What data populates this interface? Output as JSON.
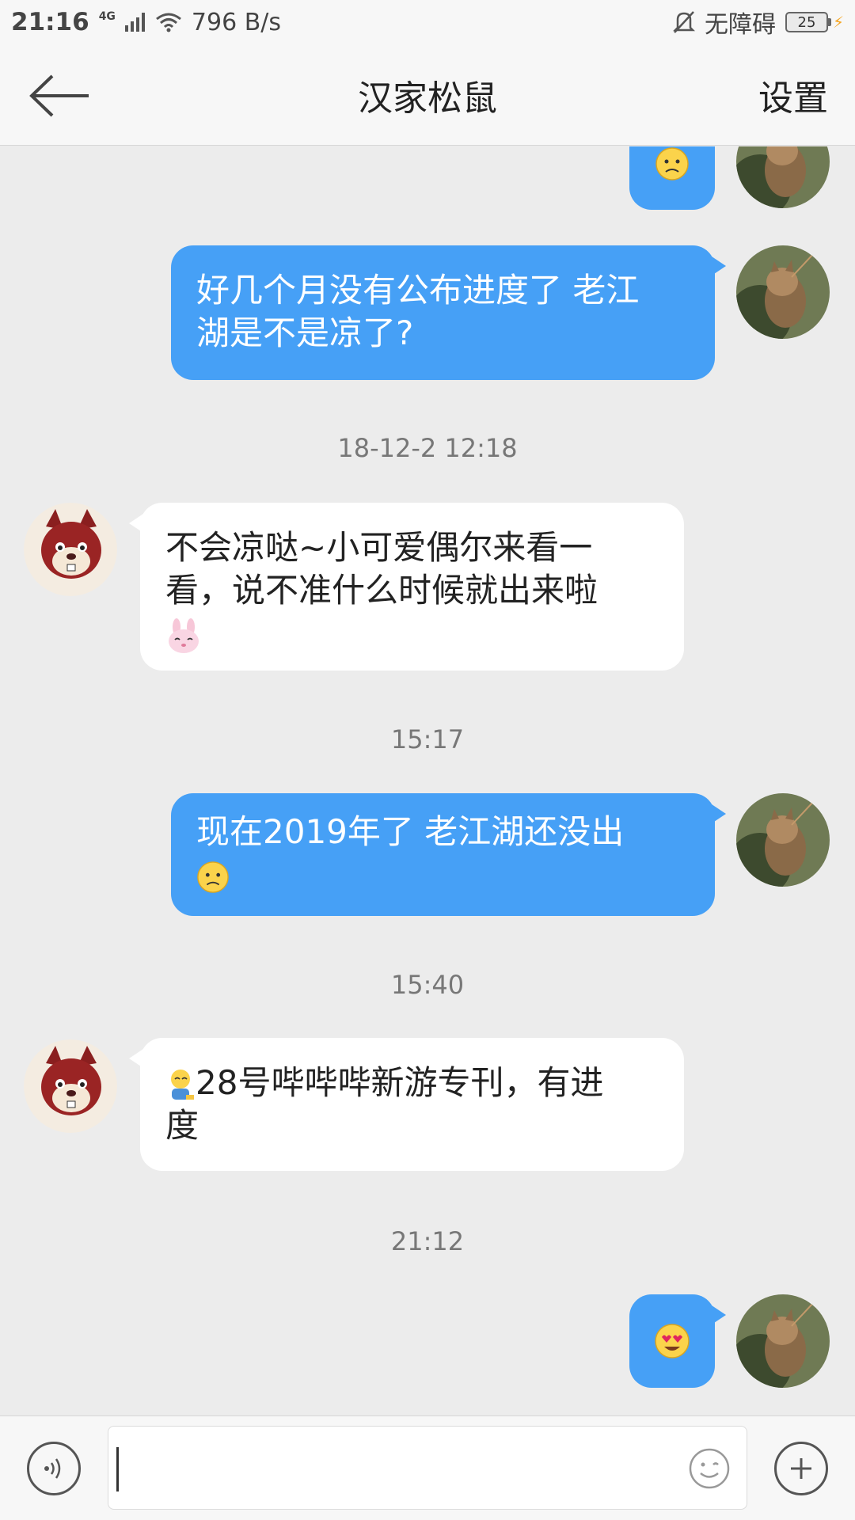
{
  "status_bar": {
    "time": "21:16",
    "network": "4G",
    "speed": "796 B/s",
    "accessibility": "无障碍",
    "battery": "25"
  },
  "header": {
    "title": "汉家松鼠",
    "settings_label": "设置"
  },
  "messages": [
    {
      "from": "self",
      "text": "好几个月没有公布进度了 老江湖是不是凉了?"
    },
    {
      "timestamp": "18-12-2 12:18"
    },
    {
      "from": "other",
      "text": "不会凉哒~小可爱偶尔来看一看，说不准什么时候就出来啦"
    },
    {
      "timestamp": "15:17"
    },
    {
      "from": "self",
      "text": "现在2019年了   老江湖还没出"
    },
    {
      "timestamp": "15:40"
    },
    {
      "from": "other",
      "text": "28号哔哔哔新游专刊，有进度"
    },
    {
      "timestamp": "21:12"
    }
  ],
  "texts": {
    "msg1_line1": "好几个月没有公布进度了 老江",
    "msg1_line2": "湖是不是凉了?",
    "msg2_line1": "不会凉哒~小可爱偶尔来看一",
    "msg2_line2": "看，说不准什么时候就出来啦",
    "msg3_line1": "现在2019年了   老江湖还没出",
    "msg4_line1": "28号哔哔哔新游专刊，有进",
    "msg4_line2": "度",
    "ts1": "18-12-2 12:18",
    "ts2": "15:17",
    "ts3": "15:40",
    "ts4": "21:12"
  },
  "colors": {
    "self_bubble": "#46a0f6",
    "other_bubble": "#ffffff",
    "background": "#ececec"
  },
  "icons": {
    "back": "arrow-left-icon",
    "voice": "voice-icon",
    "emoji": "smiley-icon",
    "plus": "plus-icon"
  }
}
